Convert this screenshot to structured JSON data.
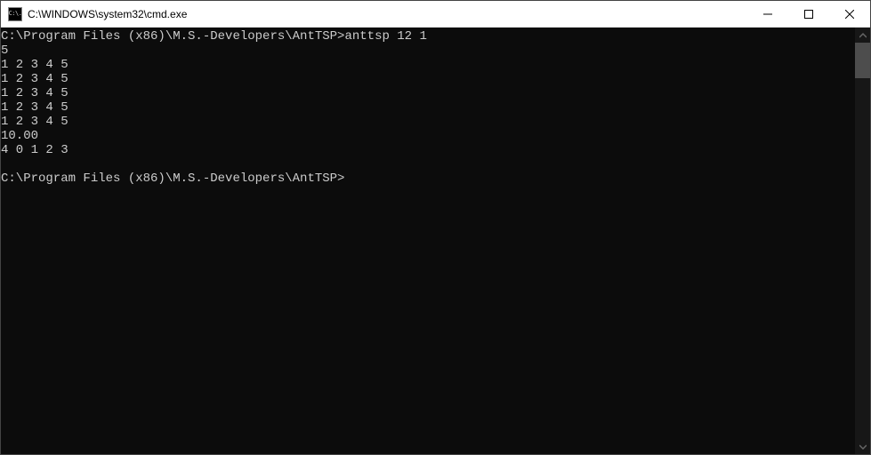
{
  "window": {
    "title": "C:\\WINDOWS\\system32\\cmd.exe",
    "icon_text": "C:\\."
  },
  "terminal": {
    "lines": [
      "C:\\Program Files (x86)\\M.S.-Developers\\AntTSP>anttsp 12 1",
      "5",
      "1 2 3 4 5",
      "1 2 3 4 5",
      "1 2 3 4 5",
      "1 2 3 4 5",
      "1 2 3 4 5",
      "10.00",
      "4 0 1 2 3",
      "",
      "C:\\Program Files (x86)\\M.S.-Developers\\AntTSP>"
    ]
  }
}
